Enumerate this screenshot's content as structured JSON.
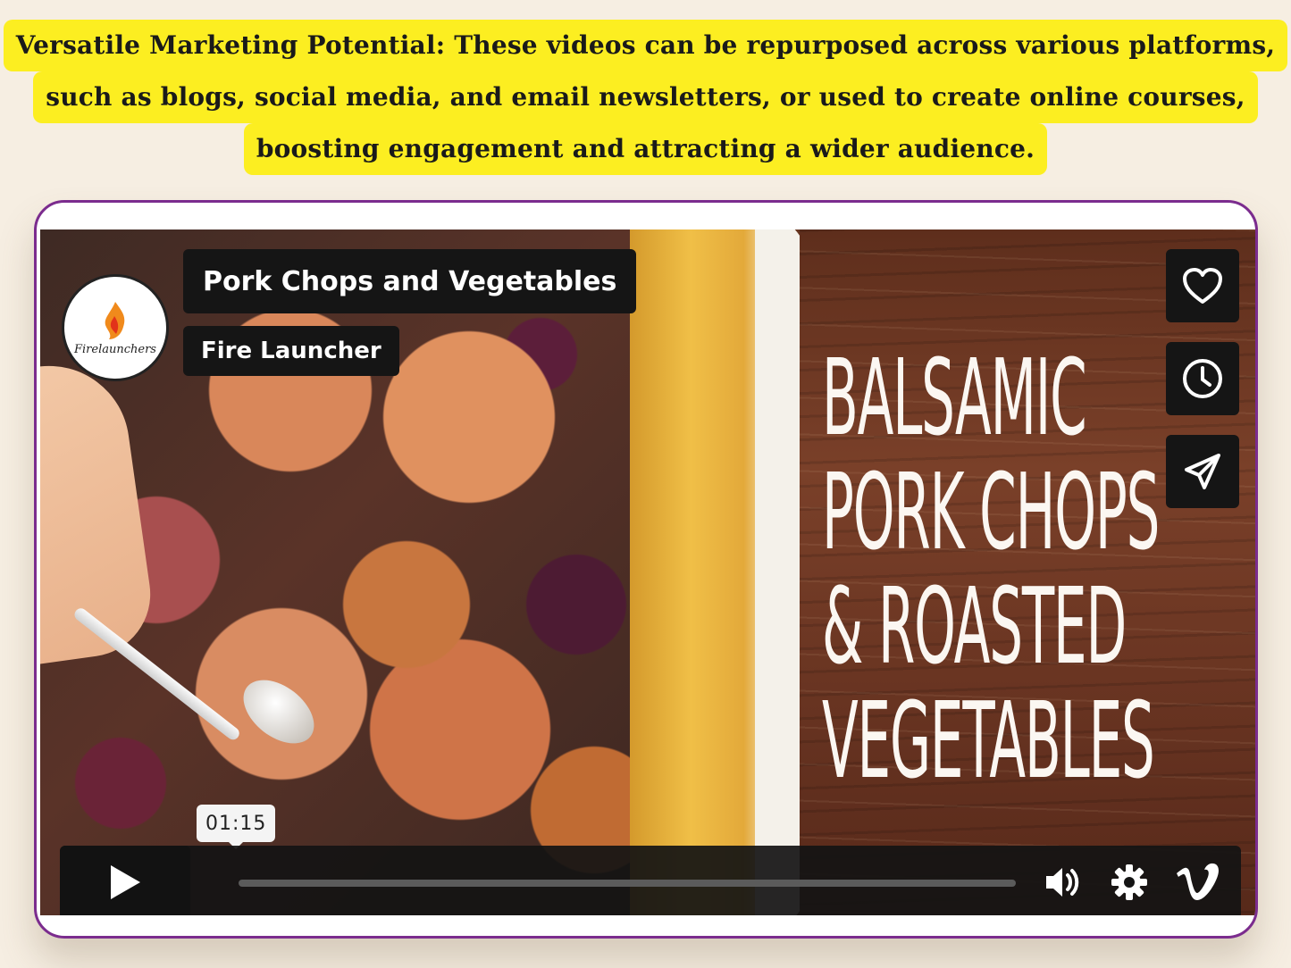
{
  "headline": {
    "lines": [
      "Versatile Marketing Potential: These videos can be repurposed across various platforms,",
      "such as blogs, social media, and email newsletters, or used to create online courses,",
      "boosting engagement and attracting a wider audience."
    ],
    "highlight_color": "#fcee21"
  },
  "player": {
    "frame_color": "#7b2c8e",
    "video_title": "Pork Chops and Vegetables",
    "author": "Fire Launcher",
    "logo_text": "Firelaunchers",
    "thumbnail_title_lines": [
      "BALSAMIC",
      "PORK CHOPS",
      "& ROASTED",
      "VEGETABLES"
    ],
    "side_buttons": [
      {
        "icon": "heart-icon"
      },
      {
        "icon": "clock-icon"
      },
      {
        "icon": "paper-plane-icon"
      }
    ],
    "controls": {
      "time": "01:15",
      "progress_fraction": 0.0,
      "icons": [
        "play-icon",
        "volume-icon",
        "settings-gear-icon",
        "vimeo-logo-icon"
      ]
    }
  }
}
